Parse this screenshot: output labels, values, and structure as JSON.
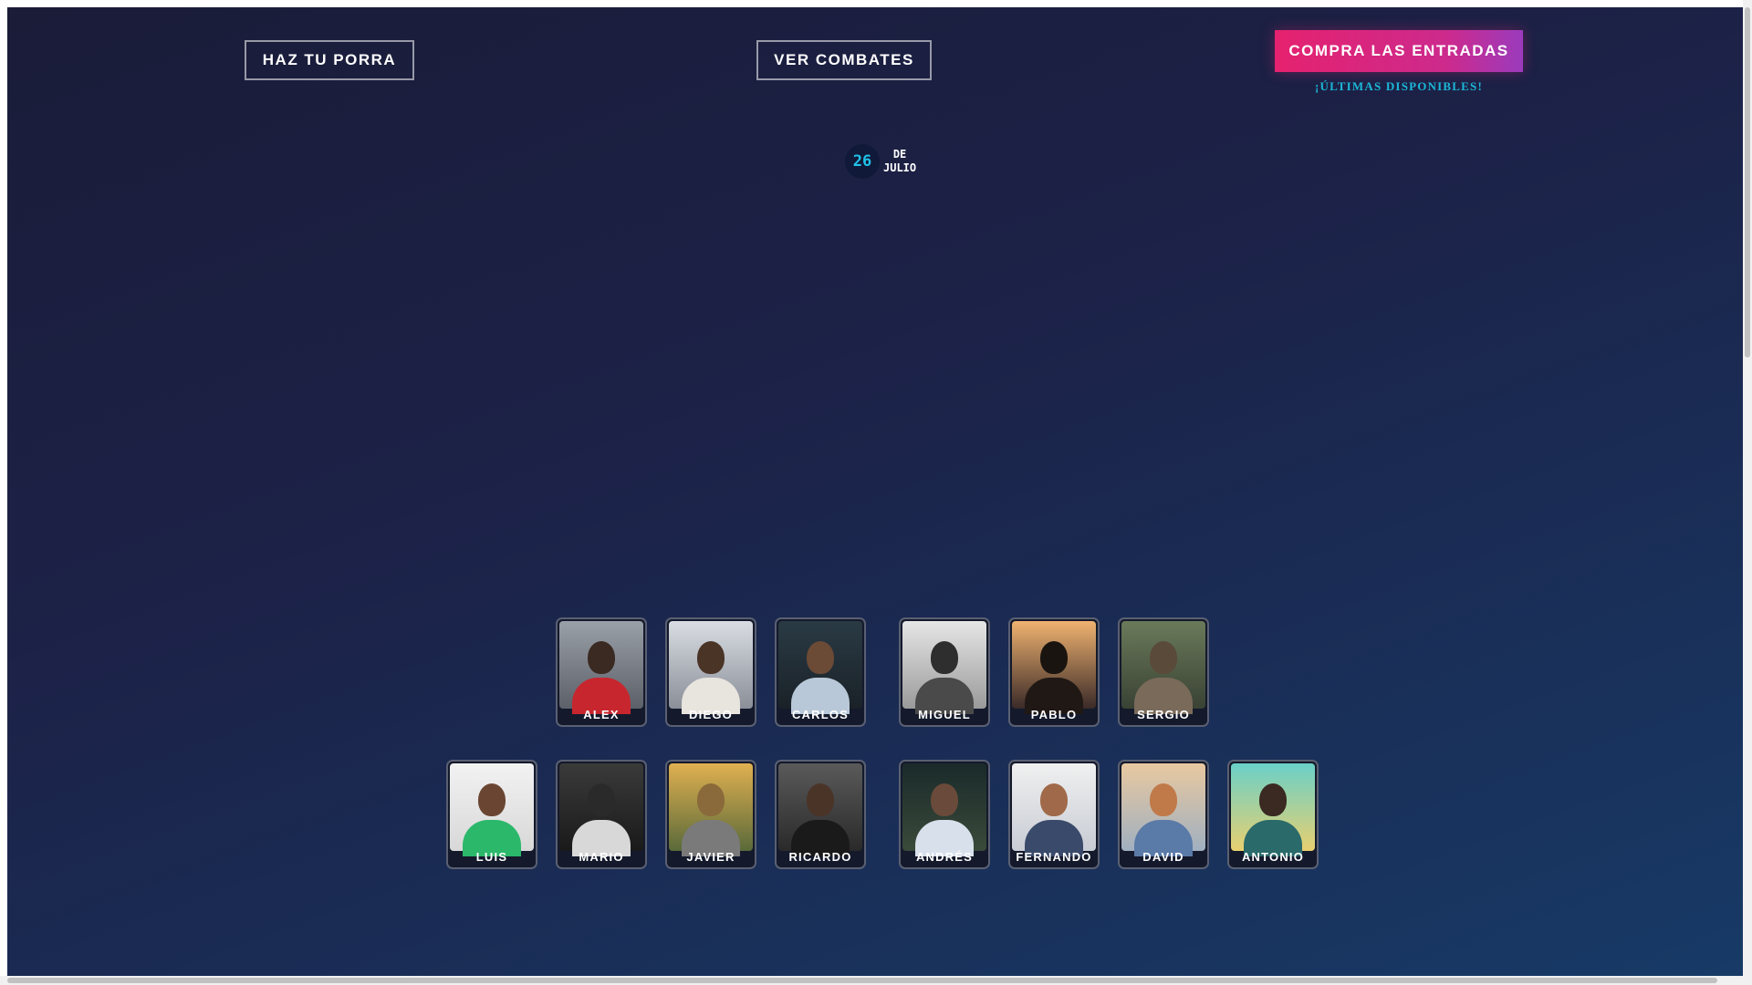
{
  "nav": {
    "porra_label": "HAZ TU PORRA",
    "combates_label": "VER COMBATES",
    "entradas_label": "COMPRA LAS ENTRADAS",
    "entradas_note": "¡ÚLTIMAS DISPONIBLES!"
  },
  "event_date": {
    "day": "26",
    "month_line1": "DE",
    "month_line2": "JULIO"
  },
  "fighters": {
    "row1": [
      "ALEX",
      "DIEGO",
      "CARLOS",
      "MIGUEL",
      "PABLO",
      "SERGIO"
    ],
    "row2": [
      "LUIS",
      "MARIO",
      "JAVIER",
      "RICARDO",
      "ANDRÉS",
      "FERNANDO",
      "DAVID",
      "ANTONIO"
    ]
  },
  "colors": {
    "accent_pink": "#e5226f",
    "accent_cyan": "#1bb8d8"
  }
}
